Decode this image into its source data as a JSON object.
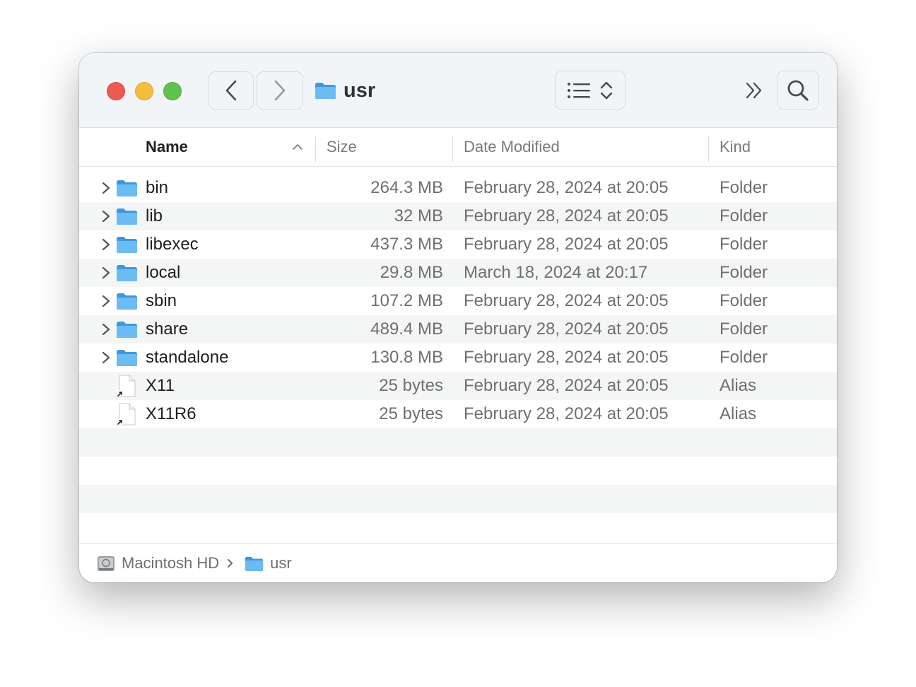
{
  "window": {
    "title": "usr"
  },
  "toolbar": {
    "back": "chevron-left-icon",
    "forward": "chevron-right-icon",
    "view": "list-view-icon",
    "more": "double-chevron-right-icon",
    "search": "search-icon"
  },
  "columns": {
    "name": "Name",
    "size": "Size",
    "date": "Date Modified",
    "kind": "Kind"
  },
  "rows": [
    {
      "name": "bin",
      "size": "264.3 MB",
      "date": "February 28, 2024 at 20:05",
      "kind": "Folder",
      "type": "folder"
    },
    {
      "name": "lib",
      "size": "32 MB",
      "date": "February 28, 2024 at 20:05",
      "kind": "Folder",
      "type": "folder"
    },
    {
      "name": "libexec",
      "size": "437.3 MB",
      "date": "February 28, 2024 at 20:05",
      "kind": "Folder",
      "type": "folder"
    },
    {
      "name": "local",
      "size": "29.8 MB",
      "date": "March 18, 2024 at 20:17",
      "kind": "Folder",
      "type": "folder"
    },
    {
      "name": "sbin",
      "size": "107.2 MB",
      "date": "February 28, 2024 at 20:05",
      "kind": "Folder",
      "type": "folder"
    },
    {
      "name": "share",
      "size": "489.4 MB",
      "date": "February 28, 2024 at 20:05",
      "kind": "Folder",
      "type": "folder"
    },
    {
      "name": "standalone",
      "size": "130.8 MB",
      "date": "February 28, 2024 at 20:05",
      "kind": "Folder",
      "type": "folder"
    },
    {
      "name": "X11",
      "size": "25 bytes",
      "date": "February 28, 2024 at 20:05",
      "kind": "Alias",
      "type": "alias"
    },
    {
      "name": "X11R6",
      "size": "25 bytes",
      "date": "February 28, 2024 at 20:05",
      "kind": "Alias",
      "type": "alias"
    }
  ],
  "pathbar": [
    {
      "label": "Macintosh HD",
      "icon": "hard-drive-icon"
    },
    {
      "label": "usr",
      "icon": "folder-icon"
    }
  ],
  "colors": {
    "folder": "#5eb4f0",
    "folder_dark": "#3d98df",
    "close": "#ee5a52",
    "minimize": "#f5bd3b",
    "maximize": "#5fc24c",
    "row_alt": "#f4f5f5"
  }
}
